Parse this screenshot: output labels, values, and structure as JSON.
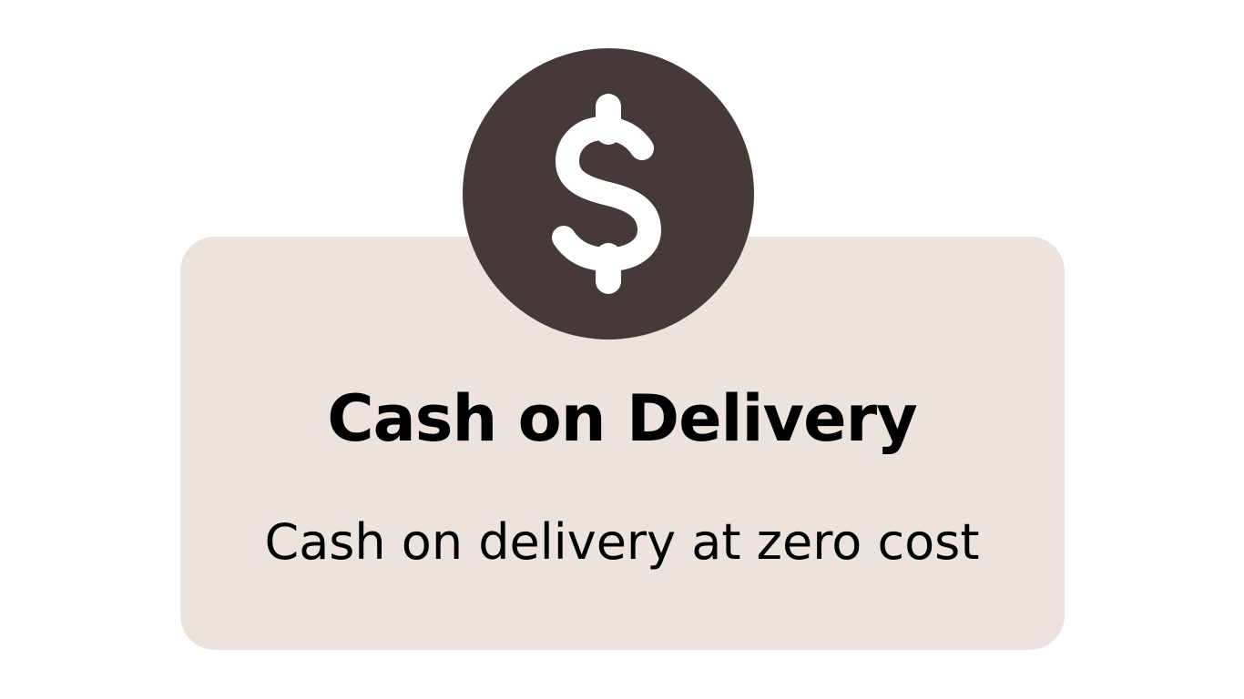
{
  "card": {
    "title": "Cash on Delivery",
    "subtitle": "Cash on delivery at zero cost",
    "icon": "dollar-sign-icon"
  },
  "colors": {
    "background": "#ffffff",
    "card_background": "#ede3de",
    "icon_circle": "#463a39",
    "icon_glyph": "#ffffff",
    "text": "#000000"
  }
}
